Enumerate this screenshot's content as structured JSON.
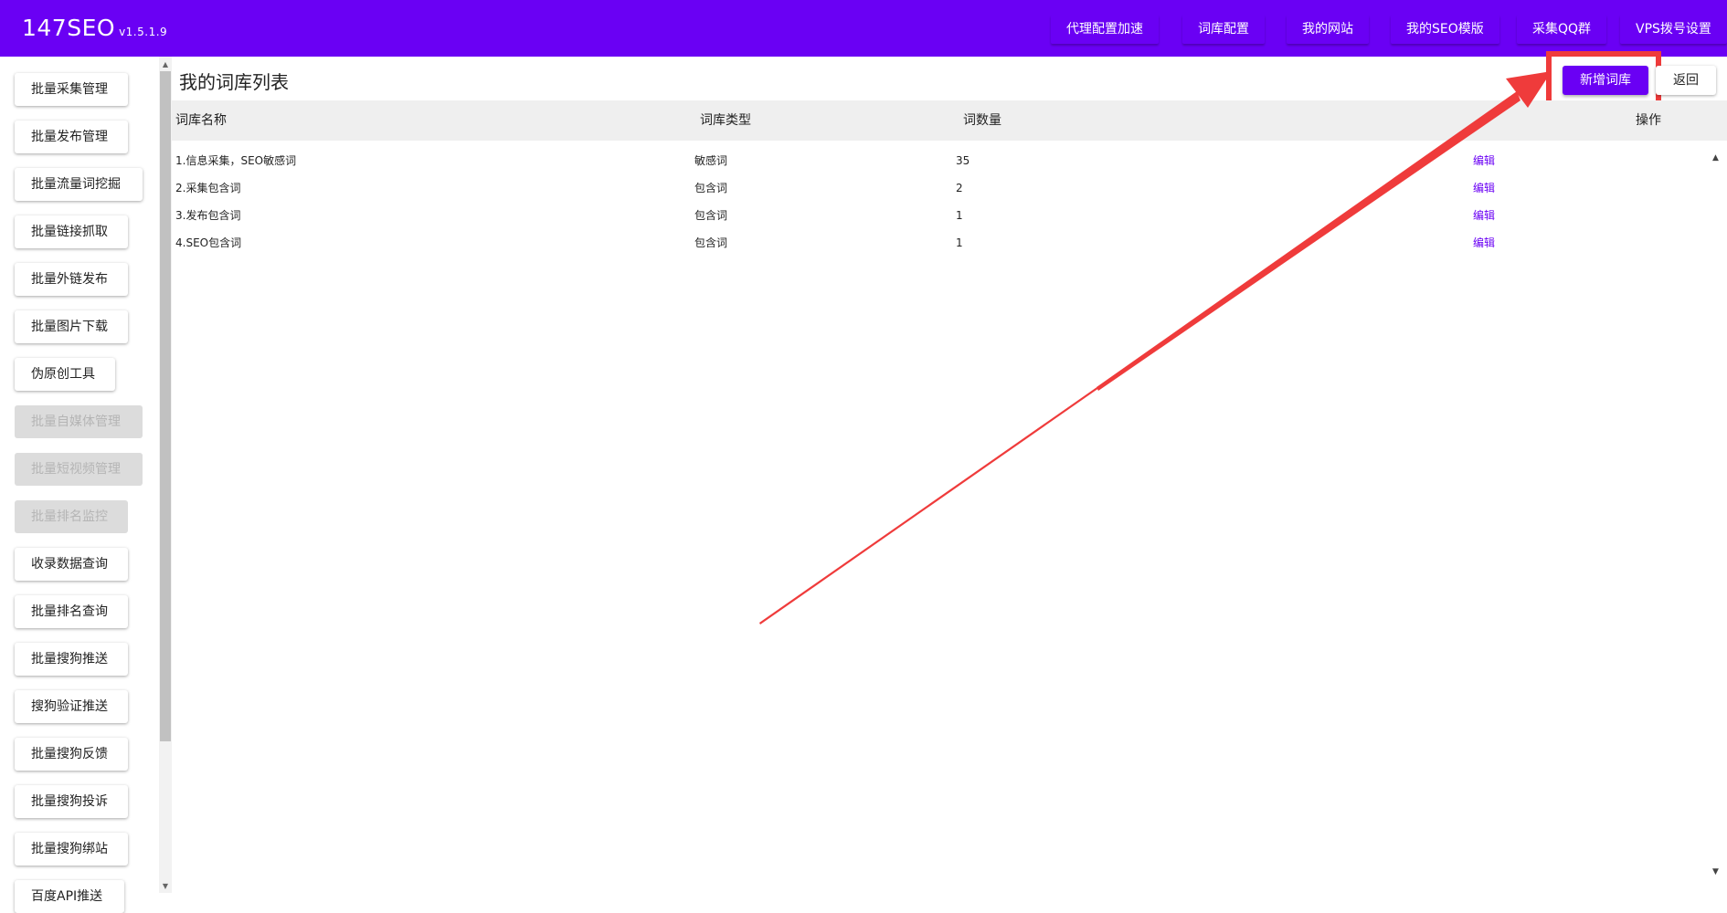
{
  "app": {
    "name": "147SEO",
    "version": "v1.5.1.9"
  },
  "topnav": [
    {
      "label": "代理配置加速"
    },
    {
      "label": "词库配置"
    },
    {
      "label": "我的网站"
    },
    {
      "label": "我的SEO模版"
    },
    {
      "label": "采集QQ群"
    },
    {
      "label": "VPS拨号设置"
    }
  ],
  "sidebar": {
    "items": [
      {
        "label": "批量采集管理",
        "disabled": false
      },
      {
        "label": "批量发布管理",
        "disabled": false
      },
      {
        "label": "批量流量词挖掘",
        "disabled": false
      },
      {
        "label": "批量链接抓取",
        "disabled": false
      },
      {
        "label": "批量外链发布",
        "disabled": false
      },
      {
        "label": "批量图片下载",
        "disabled": false
      },
      {
        "label": "伪原创工具",
        "disabled": false
      },
      {
        "label": "批量自媒体管理",
        "disabled": true
      },
      {
        "label": "批量短视频管理",
        "disabled": true
      },
      {
        "label": "批量排名监控",
        "disabled": true
      },
      {
        "label": "收录数据查询",
        "disabled": false
      },
      {
        "label": "批量排名查询",
        "disabled": false
      },
      {
        "label": "批量搜狗推送",
        "disabled": false
      },
      {
        "label": "搜狗验证推送",
        "disabled": false
      },
      {
        "label": "批量搜狗反馈",
        "disabled": false
      },
      {
        "label": "批量搜狗投诉",
        "disabled": false
      },
      {
        "label": "批量搜狗绑站",
        "disabled": false
      },
      {
        "label": "百度API推送",
        "disabled": false
      }
    ]
  },
  "main": {
    "title": "我的词库列表",
    "add_button": "新增词库",
    "back_button": "返回",
    "table": {
      "headers": [
        "词库名称",
        "词库类型",
        "词数量",
        "操作"
      ],
      "rows": [
        {
          "name": "1.信息采集，SEO敏感词",
          "type": "敏感词",
          "count": "35",
          "action": "编辑"
        },
        {
          "name": "2.采集包含词",
          "type": "包含词",
          "count": "2",
          "action": "编辑"
        },
        {
          "name": "3.发布包含词",
          "type": "包含词",
          "count": "1",
          "action": "编辑"
        },
        {
          "name": "4.SEO包含词",
          "type": "包含词",
          "count": "1",
          "action": "编辑"
        }
      ]
    }
  },
  "colors": {
    "brand": "#6a00f4",
    "annotation": "#ef3b3b",
    "disabled_bg": "#dcdcdc"
  }
}
